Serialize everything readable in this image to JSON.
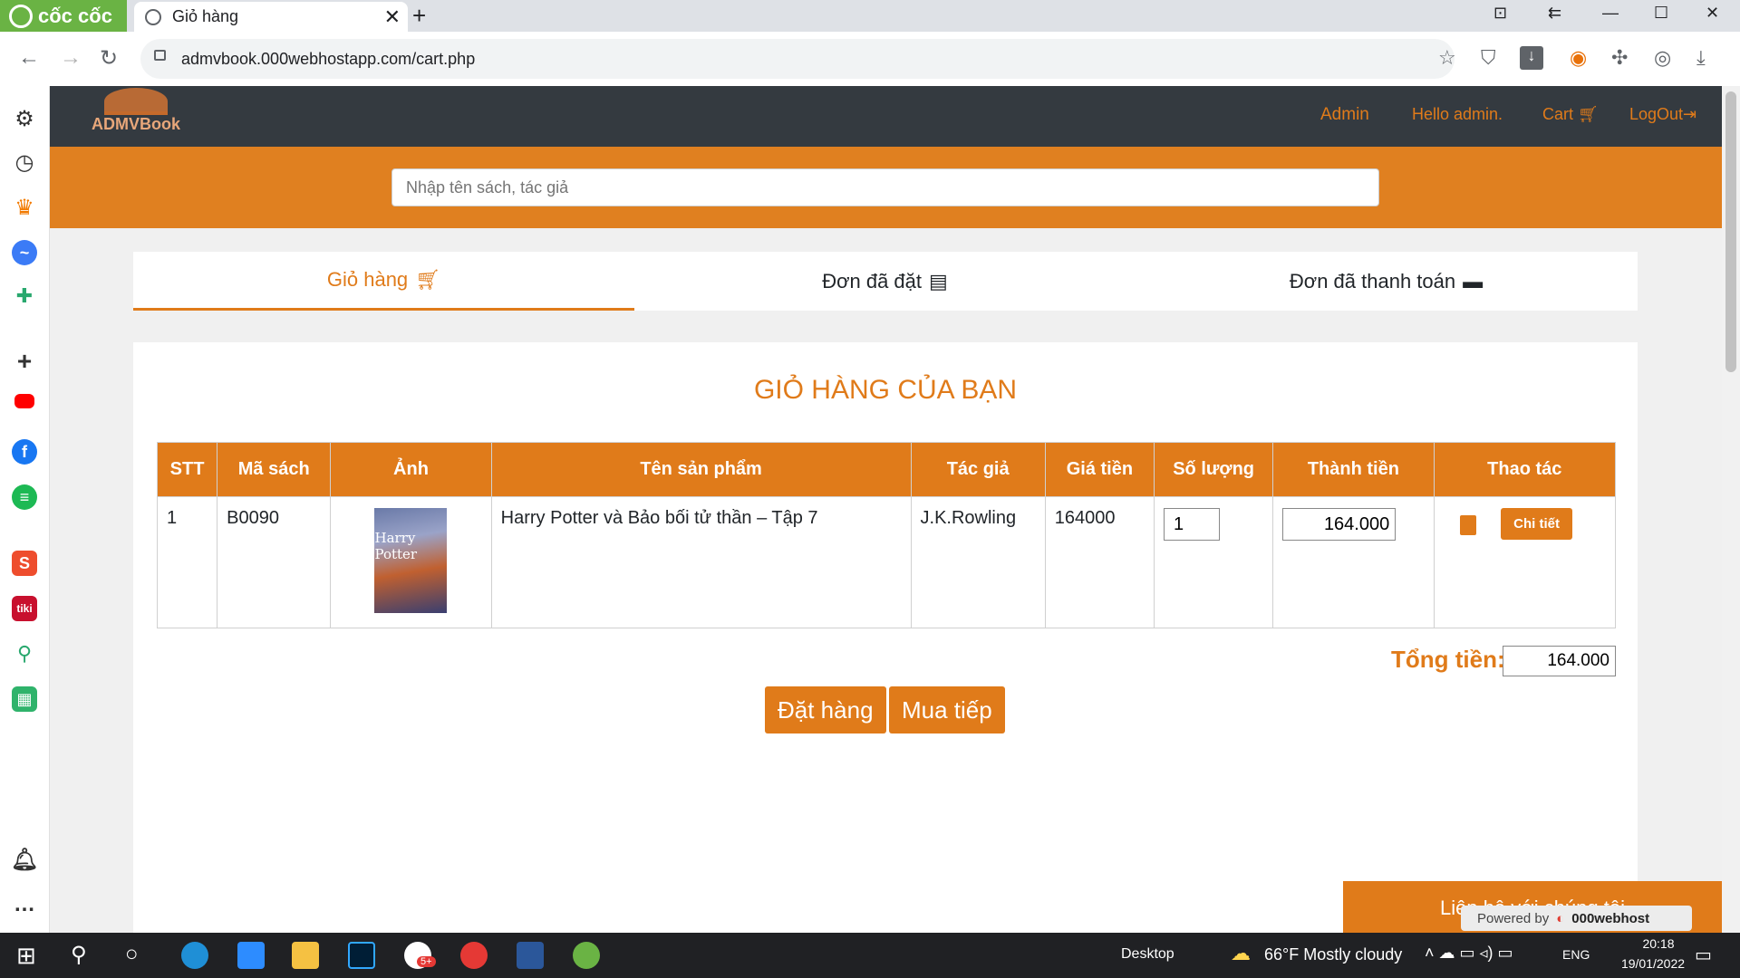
{
  "browser": {
    "brand": "cốc cốc",
    "tab_title": "Giỏ hàng",
    "url": "admvbook.000webhostapp.com/cart.php"
  },
  "site": {
    "logo_text": "ADMVBook",
    "nav": [
      "Admin",
      "Hello admin.",
      "Cart",
      "LogOut"
    ],
    "search_placeholder": "Nhập tên sách, tác giả",
    "tabs": [
      "Giỏ hàng",
      "Đơn đã đặt",
      "Đơn đã thanh toán"
    ],
    "cart_title": "GIỎ HÀNG CỦA BẠN",
    "table": {
      "headers": [
        "STT",
        "Mã sách",
        "Ảnh",
        "Tên sản phẩm",
        "Tác giả",
        "Giá tiền",
        "Số lượng",
        "Thành tiền",
        "Thao tác"
      ],
      "rows": [
        {
          "stt": "1",
          "code": "B0090",
          "cover_text": "Harry Potter",
          "name": "Harry Potter và Bảo bối tử thần – Tập 7",
          "author": "J.K.Rowling",
          "price": "164000",
          "qty": "1",
          "subtotal": "164.000",
          "detail_label": "Chi tiết"
        }
      ]
    },
    "total_label": "Tổng tiền:",
    "total_value": "164.000",
    "order_button": "Đặt hàng",
    "continue_button": "Mua tiếp",
    "contact_label": "Liên hệ với chúng tôi",
    "powered_by": "Powered by",
    "powered_brand": "000webhost",
    "accent_color": "#e07b1a"
  },
  "taskbar": {
    "desktop_label": "Desktop",
    "weather": "66°F Mostly cloudy",
    "lang": "ENG",
    "time": "20:18",
    "date": "19/01/2022",
    "zalo_badge": "5+"
  }
}
